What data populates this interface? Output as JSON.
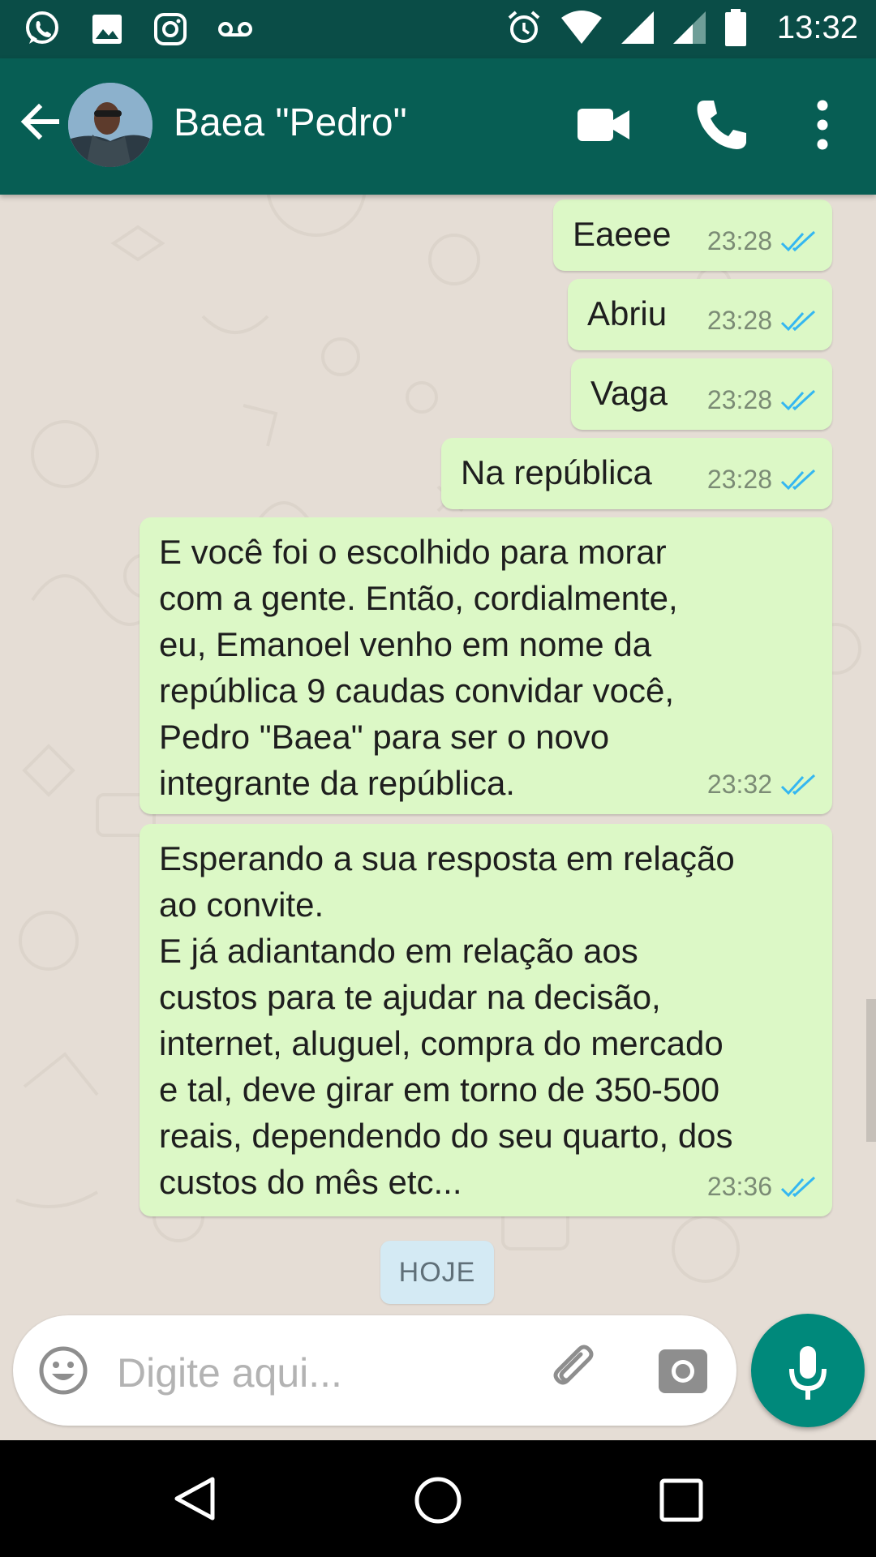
{
  "status_bar": {
    "time": "13:32",
    "left_icons": [
      "whatsapp-icon",
      "image-icon",
      "instagram-icon",
      "voicemail-icon"
    ],
    "right_icons": [
      "alarm-icon",
      "wifi-icon",
      "signal-icon",
      "signal-weak-icon",
      "battery-icon"
    ]
  },
  "header": {
    "contact_name": "Baea \"Pedro\"",
    "icons": [
      "back-arrow-icon",
      "avatar",
      "video-call-icon",
      "phone-icon",
      "more-vert-icon"
    ]
  },
  "messages": [
    {
      "text": "Eaeee",
      "time": "23:28",
      "status": "read"
    },
    {
      "text": "Abriu",
      "time": "23:28",
      "status": "read"
    },
    {
      "text": "Vaga",
      "time": "23:28",
      "status": "read"
    },
    {
      "text": "Na república",
      "time": "23:28",
      "status": "read"
    },
    {
      "text": "E você foi o escolhido para morar\ncom a gente. Então, cordialmente,\neu, Emanoel venho em nome da\nrepública 9 caudas convidar você,\nPedro \"Baea\" para ser o novo\nintegrante da república.",
      "time": "23:32",
      "status": "read"
    },
    {
      "text": "Esperando a sua resposta em relação\nao convite.\nE já adiantando em relação aos\ncustos para te ajudar na decisão,\ninternet, aluguel, compra do mercado\ne tal, deve girar em torno de 350-500\nreais, dependendo do seu quarto, dos\ncustos do mês etc...",
      "time": "23:36",
      "status": "read"
    }
  ],
  "date_divider": "HOJE",
  "composer": {
    "placeholder": "Digite aqui...",
    "icons": [
      "emoji-icon",
      "attach-icon",
      "camera-icon",
      "mic-icon"
    ]
  },
  "colors": {
    "header": "#075e54",
    "status_bar": "#0a4d47",
    "outgoing_bubble": "#dcf8c6",
    "read_ticks": "#34b7f1",
    "mic_button": "#00897b"
  },
  "nav_bar": {
    "icons": [
      "nav-back-icon",
      "nav-home-icon",
      "nav-recents-icon"
    ]
  }
}
